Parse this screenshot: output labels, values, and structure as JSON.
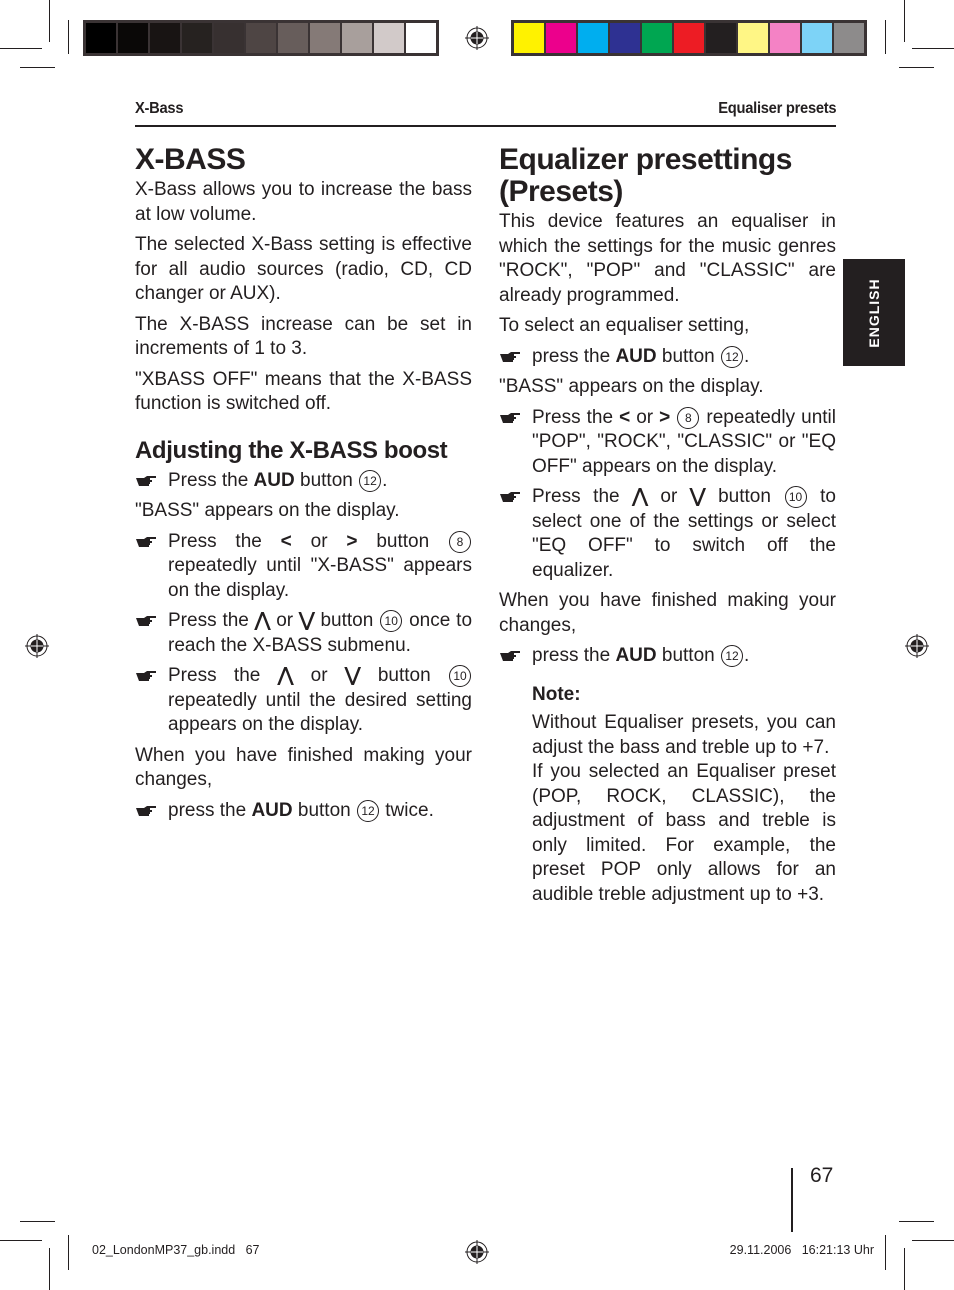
{
  "color_bars": {
    "grayscale": [
      "#000000",
      "#0a0807",
      "#181413",
      "#262220",
      "#373030",
      "#4e4544",
      "#675d5b",
      "#857a77",
      "#a89f9c",
      "#d2cac9",
      "#ffffff"
    ],
    "process": [
      "#fff200",
      "#ec008c",
      "#00aeef",
      "#2e3192",
      "#00a651",
      "#ed1c24",
      "#231f20",
      "#fff685",
      "#f482c5",
      "#7dd3f7",
      "#8d8b8b"
    ]
  },
  "running_header": {
    "left": "X-Bass",
    "right": "Equaliser presets"
  },
  "language_tab": "ENGLISH",
  "left_column": {
    "title": "X-BASS",
    "paragraphs": [
      "X-Bass allows you to increase the bass at low volume.",
      "The selected X-Bass setting is effective for all audio sources (radio, CD, CD changer or AUX).",
      "The X-BASS increase can be set in increments of 1 to 3.",
      "\"XBASS OFF\" means that the X-BASS function is switched off."
    ],
    "subheading": "Adjusting the X-BASS boost",
    "step1": {
      "pre": "Press the ",
      "bold": "AUD",
      "post": " button",
      "ref": "12",
      "end": "."
    },
    "after1": "\"BASS\" appears on the display.",
    "step2": {
      "pre": "Press the ",
      "sym1": "<",
      "or": " or ",
      "sym2": ">",
      "mid": " button",
      "ref": "8",
      "post": " repeatedly until \"X-BASS\" appears on the display."
    },
    "step3": {
      "pre": "Press the ",
      "sym1": "⋀",
      "or": " or ",
      "sym2": "⋁",
      "mid": " button",
      "ref": "10",
      "post": " once to reach the X-BASS submenu."
    },
    "step4": {
      "pre": "Press the ",
      "sym1": "⋀",
      "or": " or ",
      "sym2": "⋁",
      "mid": " button",
      "ref": "10",
      "post": " repeatedly until the desired setting appears on the display."
    },
    "after4": "When you have finished making your changes,",
    "step5": {
      "pre": "press the ",
      "bold": "AUD",
      "post": " button",
      "ref": "12",
      "end": " twice."
    }
  },
  "right_column": {
    "title": "Equalizer presettings (Presets)",
    "paragraphs": [
      "This device features an equaliser in which the settings for the music genres \"ROCK\", \"POP\" and \"CLASSIC\" are already programmed.",
      "To select an equaliser setting,"
    ],
    "step1": {
      "pre": "press the ",
      "bold": "AUD",
      "post": " button",
      "ref": "12",
      "end": "."
    },
    "after1": "\"BASS\" appears on the display.",
    "step2": {
      "pre": "Press the ",
      "sym1": "<",
      "or": " or ",
      "sym2": ">",
      "ref": "8",
      "post": " repeatedly until \"POP\", \"ROCK\", \"CLASSIC\" or \"EQ OFF\" appears on the display."
    },
    "step3": {
      "pre": "Press the ",
      "sym1": "⋀",
      "or": " or ",
      "sym2": "⋁",
      "mid": " button",
      "ref": "10",
      "post": " to select one of the settings or select \"EQ OFF\" to switch off the equalizer."
    },
    "after3": "When you have finished making your changes,",
    "step4": {
      "pre": "press the ",
      "bold": "AUD",
      "post": " button",
      "ref": "12",
      "end": "."
    },
    "note": {
      "title": "Note:",
      "text1": "Without Equaliser presets, you can adjust the bass and treble up to +7.",
      "text2": "If you selected an Equaliser preset (POP, ROCK, CLASSIC), the adjustment of bass and treble is only limited. For example, the preset POP only allows for an audible treble adjustment up to +3."
    }
  },
  "page_number": "67",
  "slug": {
    "file": "02_LondonMP37_gb.indd   67",
    "timestamp": "29.11.2006   16:21:13 Uhr"
  }
}
